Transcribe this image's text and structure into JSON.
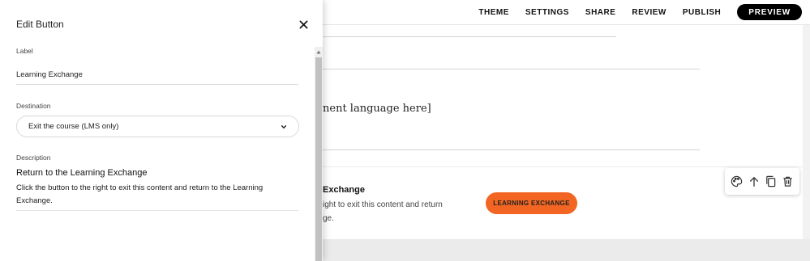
{
  "topnav": {
    "items": [
      "THEME",
      "SETTINGS",
      "SHARE",
      "REVIEW",
      "PUBLISH"
    ],
    "preview_label": "PREVIEW"
  },
  "canvas": {
    "content_text": "nent language here]",
    "block_title": "Exchange",
    "block_body_line1": "ight to exit this content and return",
    "block_body_line2": "ge.",
    "button_label": "LEARNING EXCHANGE",
    "button_color": "#f26522"
  },
  "toolbar": {
    "icons": [
      "palette-icon",
      "arrow-up-icon",
      "duplicate-icon",
      "trash-icon"
    ]
  },
  "panel": {
    "title": "Edit Button",
    "label_field": {
      "label": "Label",
      "value": "Learning Exchange"
    },
    "destination_field": {
      "label": "Destination",
      "value": "Exit the course (LMS only)"
    },
    "description_field": {
      "label": "Description",
      "title": "Return to the Learning Exchange",
      "body": "Click the button to the right to exit this content and return to the Learning Exchange."
    }
  }
}
